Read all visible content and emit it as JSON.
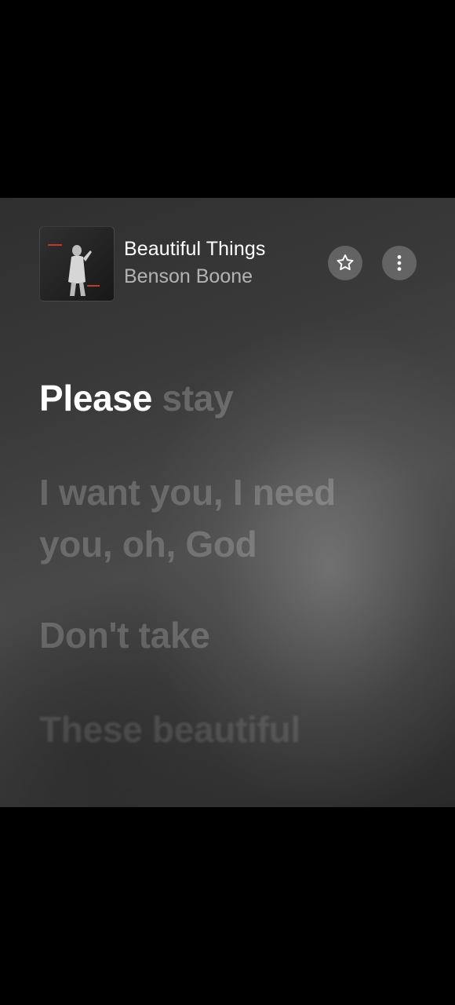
{
  "now_playing": {
    "title": "Beautiful Things",
    "artist": "Benson Boone",
    "album_art_icon": "album-cover-image"
  },
  "actions": {
    "favorite_icon": "star-icon",
    "more_icon": "more-vertical-icon"
  },
  "lyrics": {
    "current_line": {
      "sung": "Please",
      "unsung": "stay"
    },
    "lines": [
      "I want you, I need you, oh, God",
      "Don't take",
      "These beautiful"
    ]
  },
  "colors": {
    "background": "#000000",
    "panel": "#3a3a3a",
    "active_text": "#ffffff"
  }
}
